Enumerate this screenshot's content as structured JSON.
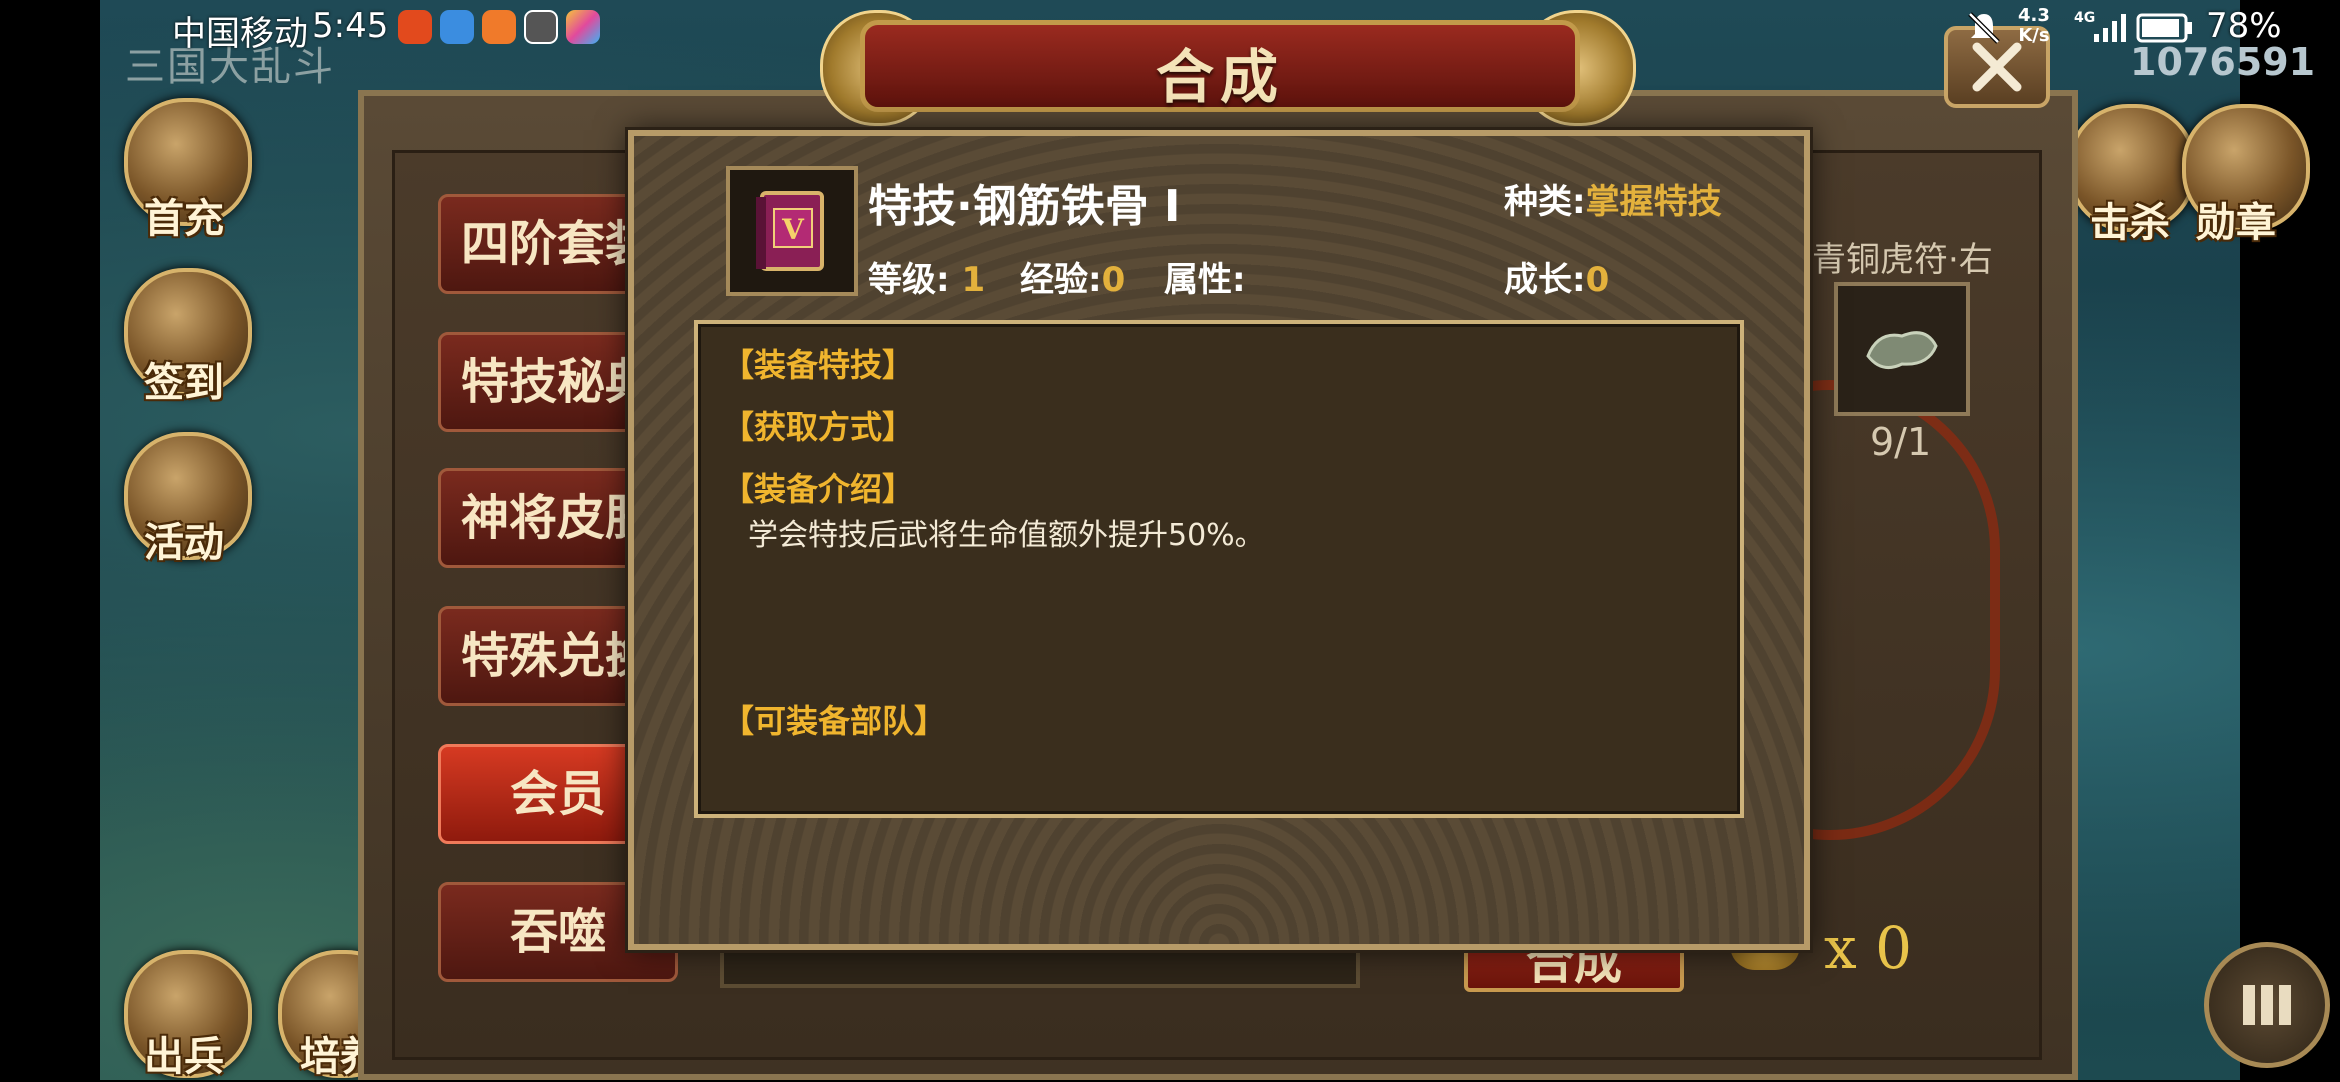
{
  "status_bar": {
    "carrier": "中国移动",
    "time": "5:45",
    "net_speed_value": "4.3",
    "net_speed_unit": "K/s",
    "network": "4G",
    "battery": "78%"
  },
  "game": {
    "title": "三国大乱斗",
    "currency": "1076591",
    "left_buttons": [
      {
        "label": "首充"
      },
      {
        "label": "签到"
      },
      {
        "label": "活动"
      },
      {
        "label": "出兵"
      },
      {
        "label": "培养"
      }
    ],
    "right_buttons": [
      {
        "label": "击杀"
      },
      {
        "label": "勋章"
      }
    ]
  },
  "panel": {
    "title": "合成",
    "menu": [
      {
        "label": "四阶套装"
      },
      {
        "label": "特技秘典"
      },
      {
        "label": "神将皮肤"
      },
      {
        "label": "特殊兑换"
      },
      {
        "label": "会员"
      },
      {
        "label": "吞噬"
      }
    ],
    "material_name": "青铜虎符·右",
    "material_count": "9/1",
    "compose_label": "合成",
    "coin_count": "x 0"
  },
  "dialog": {
    "item_name": "特技·钢筋铁骨 Ⅰ",
    "icon_letter": "V",
    "type_label": "种类:",
    "type_value": "掌握特技",
    "level_label": "等级:",
    "level_value": "1",
    "exp_label": "经验:",
    "exp_value": "0",
    "attr_label": "属性:",
    "growth_label": "成长:",
    "growth_value": "0",
    "sections": {
      "equip_skill": "【装备特技】",
      "obtain_method": "【获取方式】",
      "equip_intro": "【装备介绍】",
      "intro_text": "学会特技后武将生命值额外提升50%。",
      "equippable_troops": "【可装备部队】"
    }
  },
  "colors": {
    "accent_gold": "#e3b13c",
    "section_orange": "#f0b52e",
    "active_red": "#d63a22"
  },
  "icons": {
    "close": "close-icon",
    "book": "skill-book-icon",
    "menu": "menu-grid-icon"
  }
}
